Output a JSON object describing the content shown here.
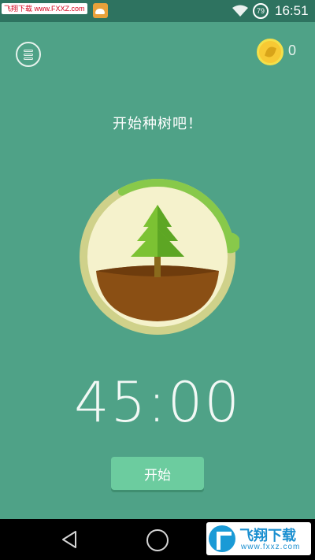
{
  "status_bar": {
    "watermark_text": "飞翔下载 www.FXXZ.com",
    "battery_level": "79",
    "time": "16:51",
    "icons": [
      "notification-icon",
      "app-notification-icon",
      "wifi-icon",
      "battery-icon"
    ]
  },
  "header": {
    "menu_icon": "menu-icon",
    "coin_icon": "coin-icon",
    "coin_count": "0"
  },
  "main": {
    "title": "开始种树吧！",
    "timer_progress": 0.22,
    "timer": "45:00",
    "start_label": "开始"
  },
  "nav_bar": {
    "icons": [
      "back-icon",
      "home-icon"
    ]
  },
  "watermark": {
    "title": "飞翔下载",
    "url": "www.fxxz.com"
  },
  "colors": {
    "background": "#4fa287",
    "status_bar": "#2e7360",
    "ring_track": "#cfd18a",
    "ring_progress": "#88c94a",
    "button": "#6ccc9f",
    "soil": "#8a4f14",
    "tree": "#7cc233"
  }
}
